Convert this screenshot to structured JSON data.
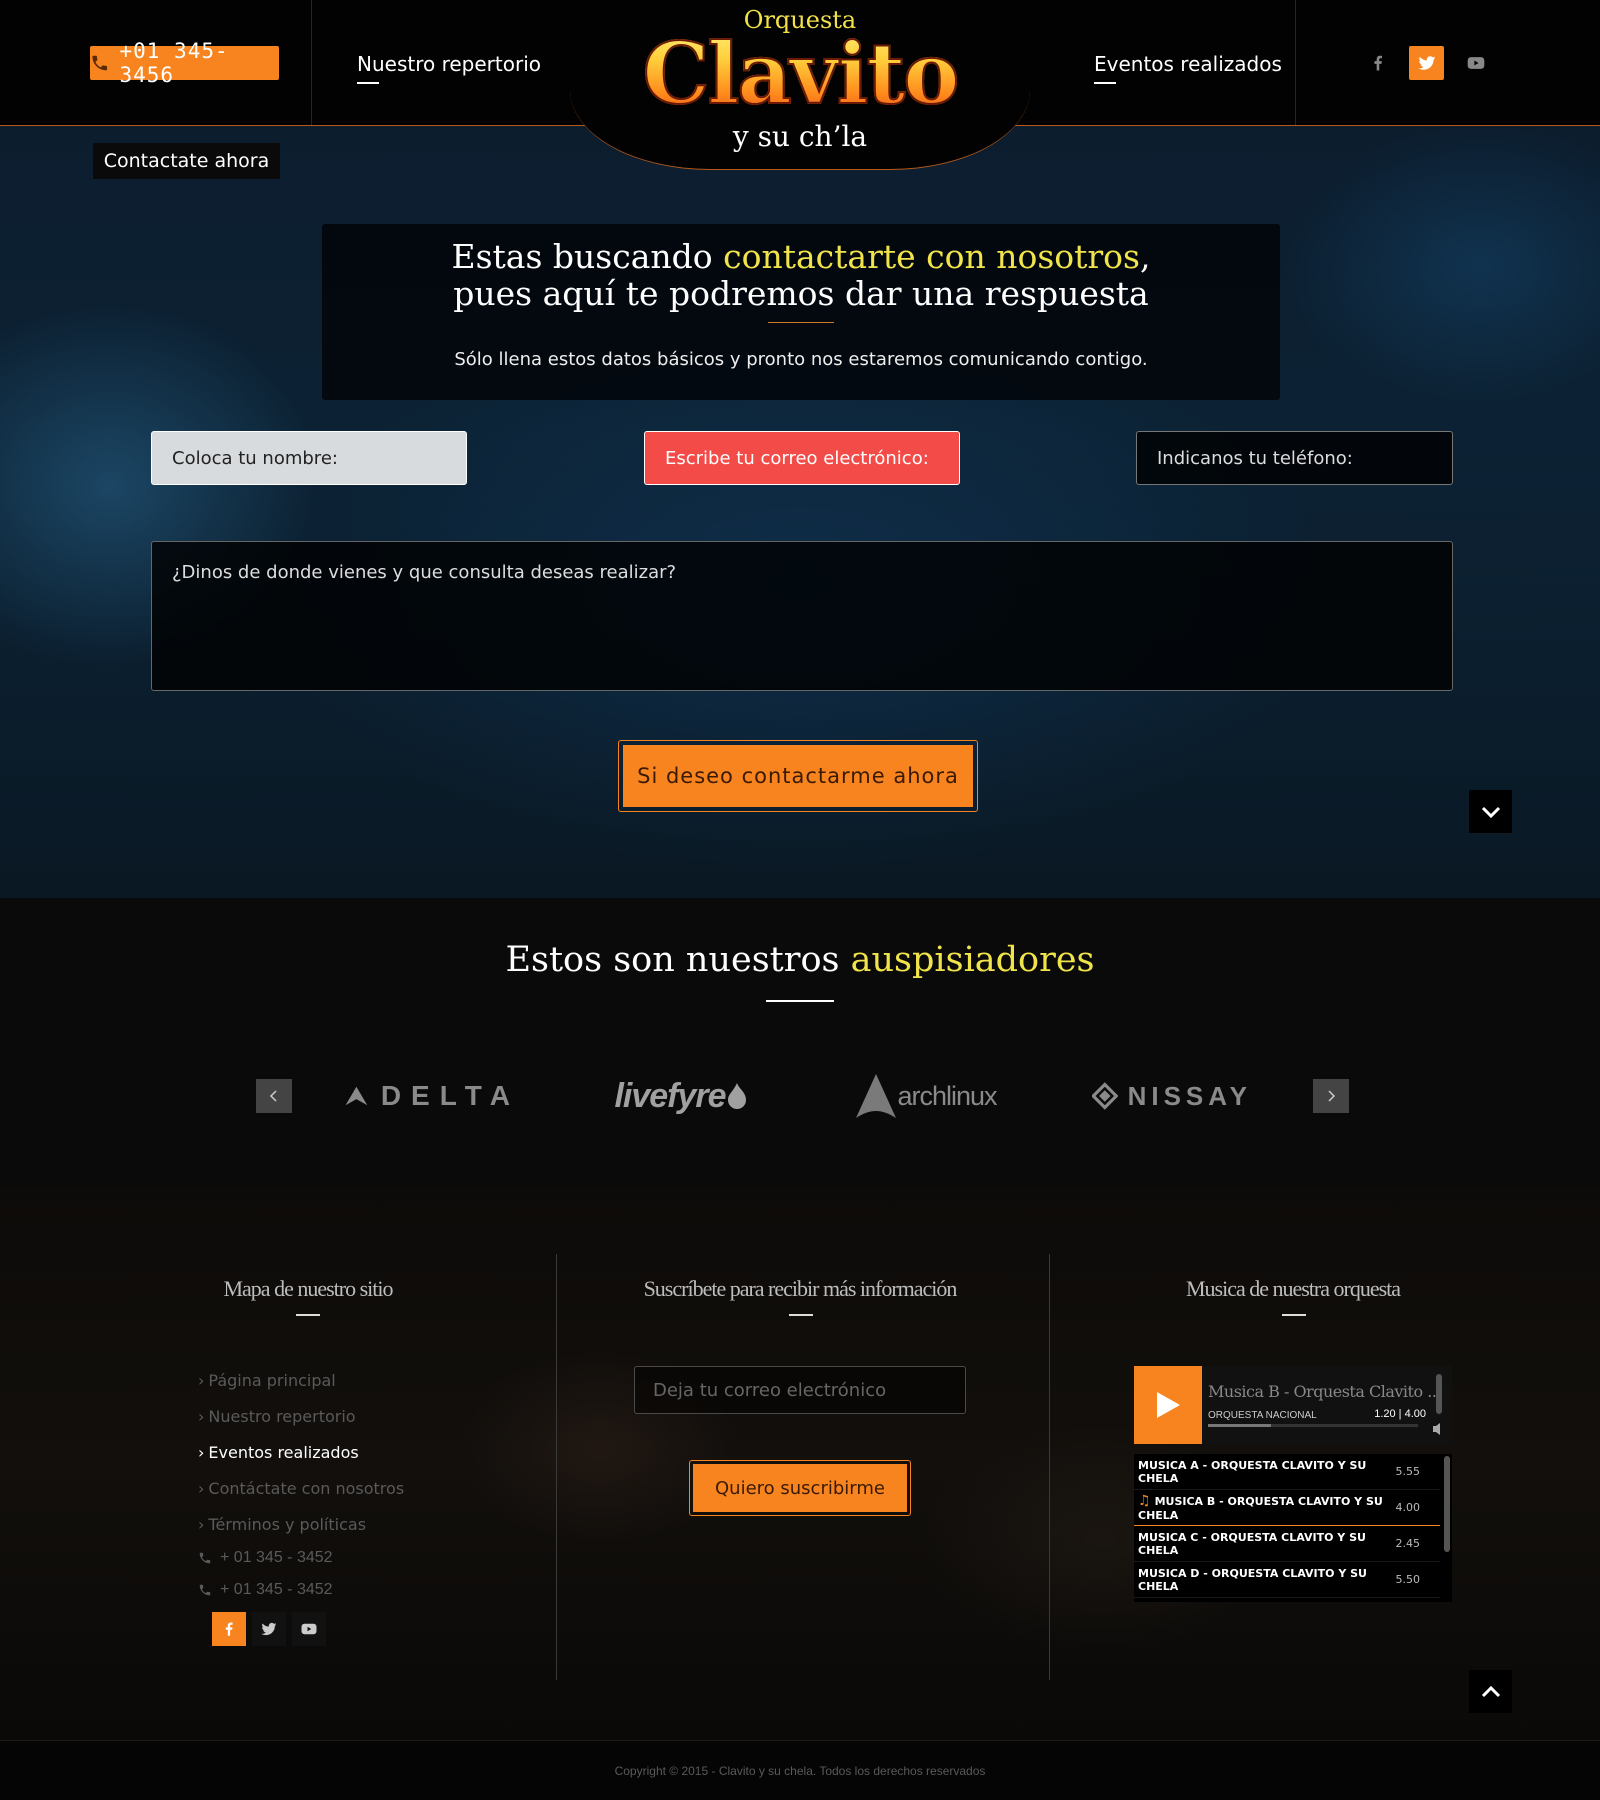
{
  "header": {
    "phone": "+01 345-3456",
    "nav_left": "Nuestro repertorio",
    "nav_right": "Eventos realizados",
    "logo_top": "Orquesta",
    "logo_main": "Clavito",
    "logo_sub": "y su ch’la",
    "accent_color": "#f7841e"
  },
  "hero": {
    "tag": "Contactate ahora",
    "title_a": "Estas buscando ",
    "title_hl": "contactarte con nosotros",
    "title_b": ",",
    "title_line2": "pues aquí te podremos dar una respuesta",
    "intro_text": "Sólo llena estos datos básicos y pronto nos estaremos comunicando contigo.",
    "name_placeholder": "Coloca tu nombre:",
    "email_placeholder": "Escribe tu correo electrónico:",
    "phone_placeholder": "Indicanos tu teléfono:",
    "message_placeholder": "¿Dinos de donde vienes y que consulta deseas realizar?",
    "submit_label": "Si deseo contactarme ahora"
  },
  "sponsors": {
    "title_a": "Estos son nuestros ",
    "title_hl": "auspisiadores",
    "logos": [
      "DELTA",
      "livefyre",
      "archlinux",
      "NISSAY"
    ]
  },
  "footer": {
    "sitemap_title": "Mapa de nuestro sitio",
    "sitemap_items": [
      "Página principal",
      "Nuestro repertorio",
      "Eventos realizados",
      "Contáctate con nosotros",
      "Términos y políticas"
    ],
    "phones": [
      "+ 01 345 - 3452",
      "+ 01 345 - 3452"
    ],
    "subscribe_title": "Suscríbete para recibir más información",
    "subscribe_placeholder": "Deja tu correo electrónico",
    "subscribe_button": "Quiero suscribirme",
    "music_title": "Musica de nuestra orquesta",
    "player": {
      "track": "Musica B - Orquesta Clavito ...",
      "artist": "ORQUESTA NACIONAL",
      "time": "1.20 | 4.00",
      "progress": 0.3,
      "playlist": [
        {
          "title": "MUSICA A - ORQUESTA CLAVITO Y SU CHELA",
          "duration": "5.55"
        },
        {
          "title": "MUSICA B - ORQUESTA CLAVITO Y SU CHELA",
          "duration": "4.00"
        },
        {
          "title": "MUSICA C - ORQUESTA CLAVITO Y SU CHELA",
          "duration": "2.45"
        },
        {
          "title": "MUSICA D - ORQUESTA CLAVITO Y SU CHELA",
          "duration": "5.50"
        }
      ]
    },
    "copyright": "Copyright © 2015 - Clavito y su chela. Todos los derechos reservados"
  }
}
